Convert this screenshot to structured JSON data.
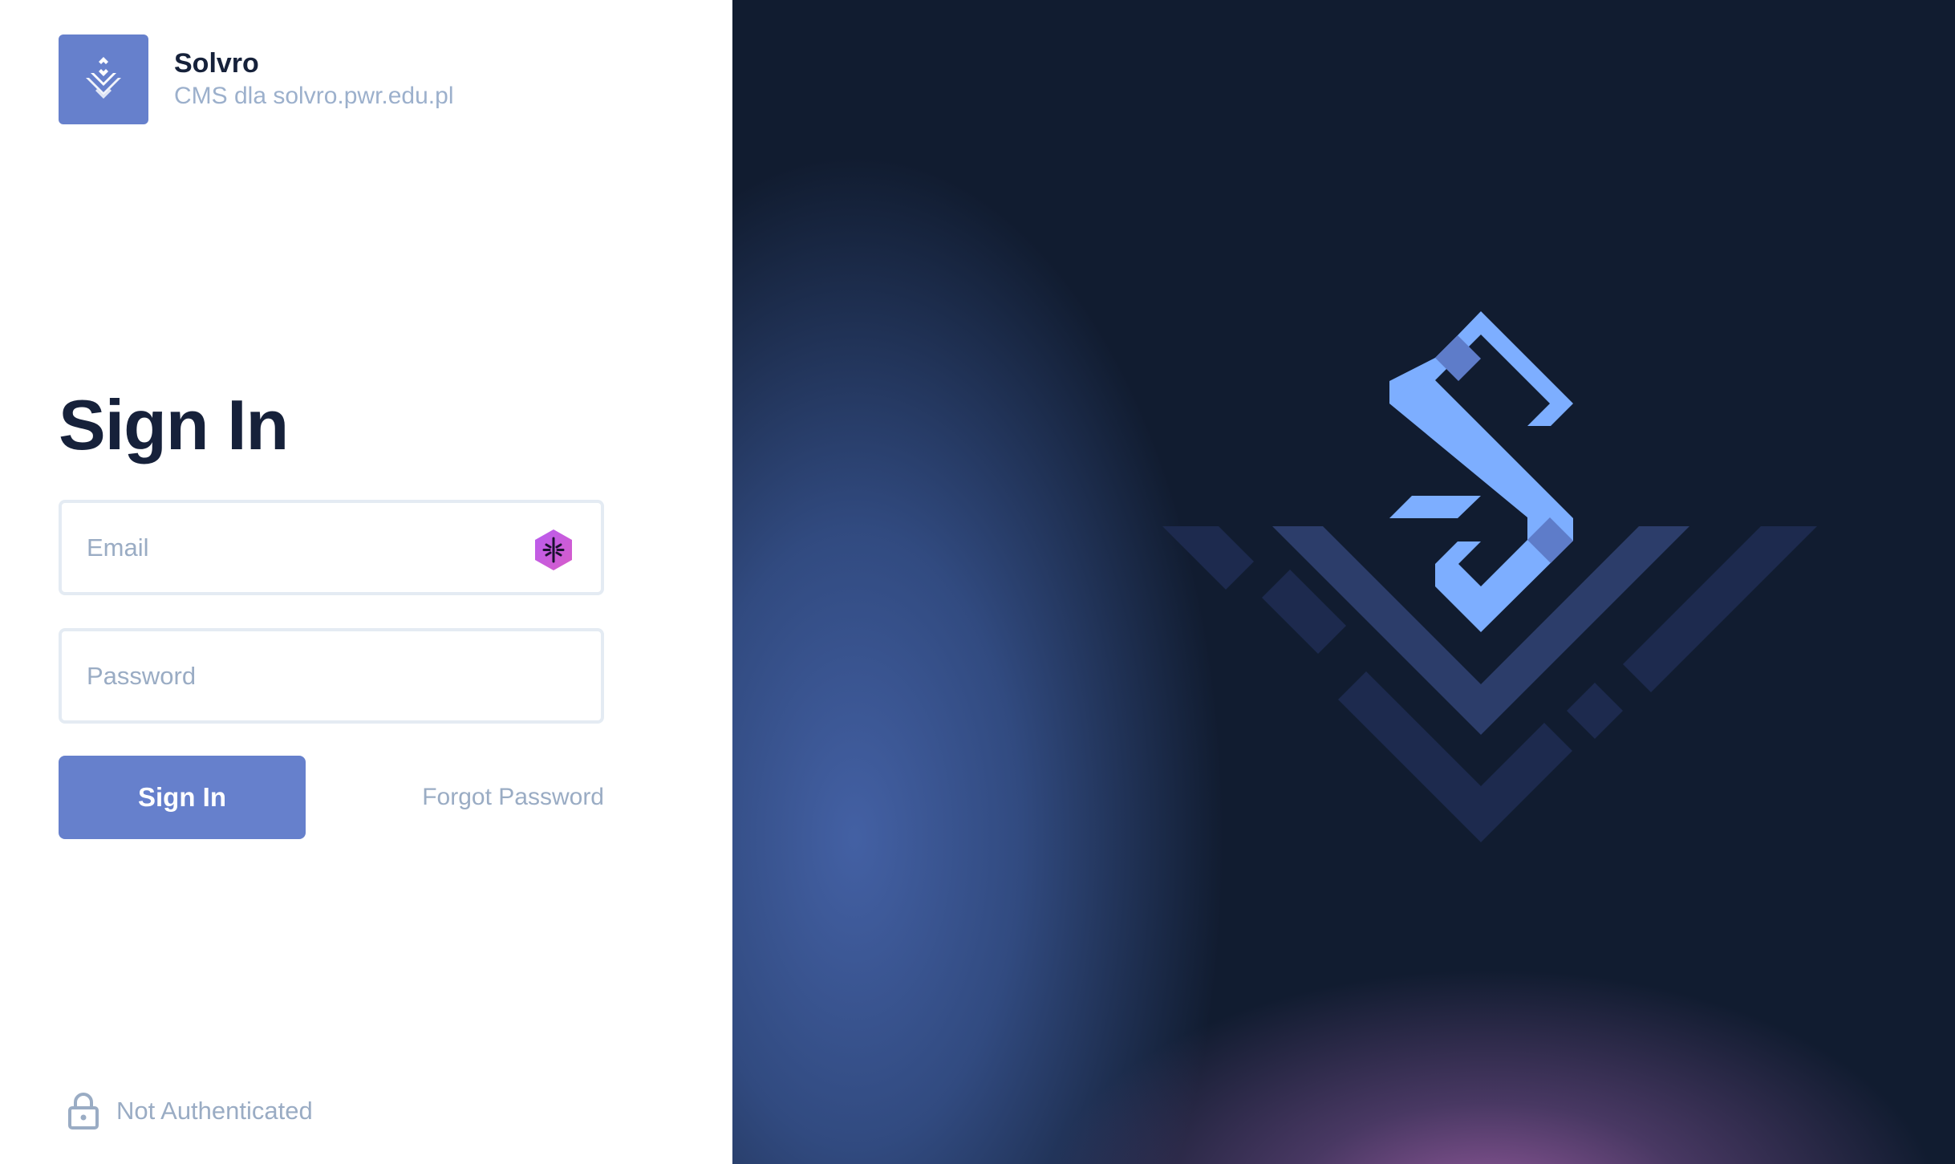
{
  "brand": {
    "name": "Solvro",
    "subtitle": "CMS dla solvro.pwr.edu.pl",
    "logo_icon": "solvro-logo-icon",
    "accent_color": "#6680cc"
  },
  "login": {
    "title": "Sign In",
    "email": {
      "placeholder": "Email",
      "value": "",
      "autofill_icon": "password-manager-icon"
    },
    "password": {
      "placeholder": "Password",
      "value": ""
    },
    "submit_label": "Sign In",
    "forgot_label": "Forgot Password"
  },
  "status": {
    "icon": "lock-icon",
    "text": "Not Authenticated"
  },
  "hero": {
    "logo_icon": "solvro-logo-icon",
    "background_color": "#111c30",
    "logo_color": "#7daeff"
  }
}
